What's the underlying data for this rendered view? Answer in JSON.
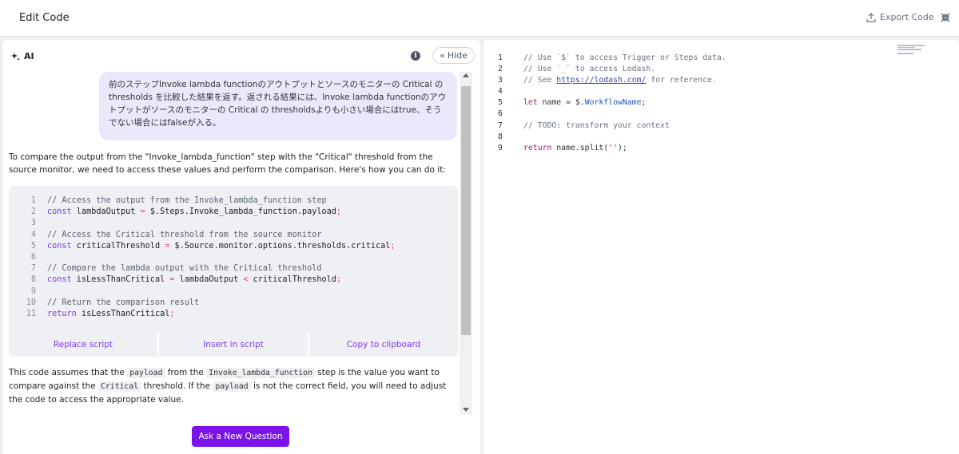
{
  "header": {
    "title": "Edit Code",
    "export_label": "Export Code"
  },
  "ai_panel": {
    "title": "AI",
    "hide_label": "Hide",
    "user_message": "前のステップInvoke lambda functionのアウトプットとソースのモニターの Critical の thresholds を比較した結果を返す。返される結果には、Invoke lambda functionのアウトプットがソースのモニターの Critical の thresholdsよりも小さい場合にはtrue、そうでない場合にはfalseが入る。",
    "intro": "To compare the output from the \"Invoke_lambda_function\" step with the \"Critical\" threshold from the source monitor, we need to access these values and perform the comparison. Here's how you can do it:",
    "code_lines": [
      "// Access the output from the Invoke_lambda_function step",
      "const lambdaOutput = $.Steps.Invoke_lambda_function.payload;",
      "",
      "// Access the Critical threshold from the source monitor",
      "const criticalThreshold = $.Source.monitor.options.thresholds.critical;",
      "",
      "// Compare the lambda output with the Critical threshold",
      "const isLessThanCritical = lambdaOutput < criticalThreshold;",
      "",
      "// Return the comparison result",
      "return isLessThanCritical;"
    ],
    "actions": {
      "replace": "Replace script",
      "insert": "Insert in script",
      "copy": "Copy to clipboard"
    },
    "note": {
      "p1": "This code assumes that the ",
      "c1": "payload",
      "p2": " from the ",
      "c2": "Invoke_lambda_function",
      "p3": " step is the value you want to compare against the ",
      "c3": "Critical",
      "p4": " threshold. If the ",
      "c4": "payload",
      "p5": " is not the correct field, you will need to adjust the code to access the appropriate value."
    },
    "ask_button": "Ask a New Question"
  },
  "editor": {
    "lines": [
      "// Use `$` to access Trigger or Steps data.",
      "// Use `_` to access Lodash.",
      "// See https://lodash.com/ for reference.",
      "",
      "let name = $.WorkflowName;",
      "",
      "// TODO: transform your context",
      "",
      "return name.split('');"
    ],
    "link": "https://lodash.com/"
  },
  "colors": {
    "accent": "#7c13e8",
    "bubble": "#ece7fb",
    "code_bg": "#eef0f3"
  }
}
